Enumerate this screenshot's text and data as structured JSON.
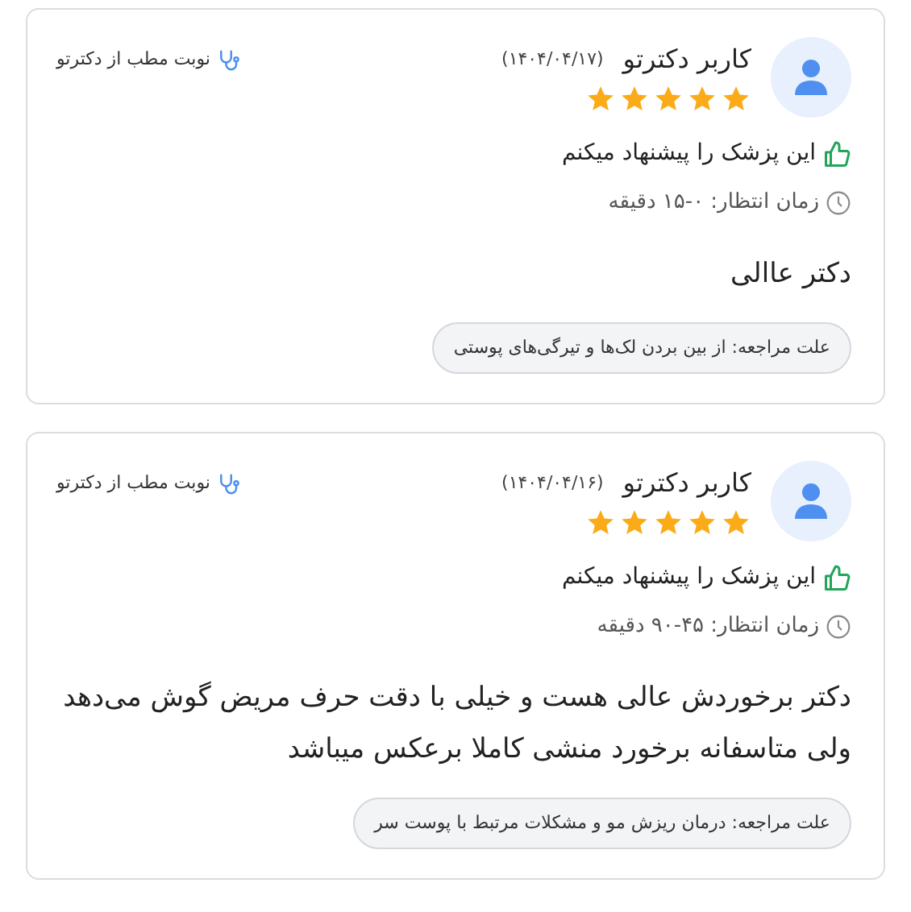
{
  "reviews": [
    {
      "user_name": "کاربر دکترتو",
      "date": "(۱۴۰۴/۰۴/۱۷)",
      "stars": 5,
      "source": "نوبت مطب از دکترتو",
      "recommendation": "این پزشک را پیشنهاد میکنم",
      "wait_time": "زمان انتظار: ۰-۱۵ دقیقه",
      "comment": "دکتر عاالی",
      "reason": "علت مراجعه:  از بین بردن لک‌ها و تیرگی‌های پوستی"
    },
    {
      "user_name": "کاربر دکترتو",
      "date": "(۱۴۰۴/۰۴/۱۶)",
      "stars": 5,
      "source": "نوبت مطب از دکترتو",
      "recommendation": "این پزشک را پیشنهاد میکنم",
      "wait_time": "زمان انتظار: ۴۵-۹۰ دقیقه",
      "comment": "دکتر برخوردش عالی هست و خیلی با دقت حرف مریض گوش می‌دهد ولی متاسفانه برخورد منشی کاملا برعکس میباشد",
      "reason": "علت مراجعه:  درمان ریزش مو و مشکلات مرتبط با پوست سر"
    }
  ]
}
